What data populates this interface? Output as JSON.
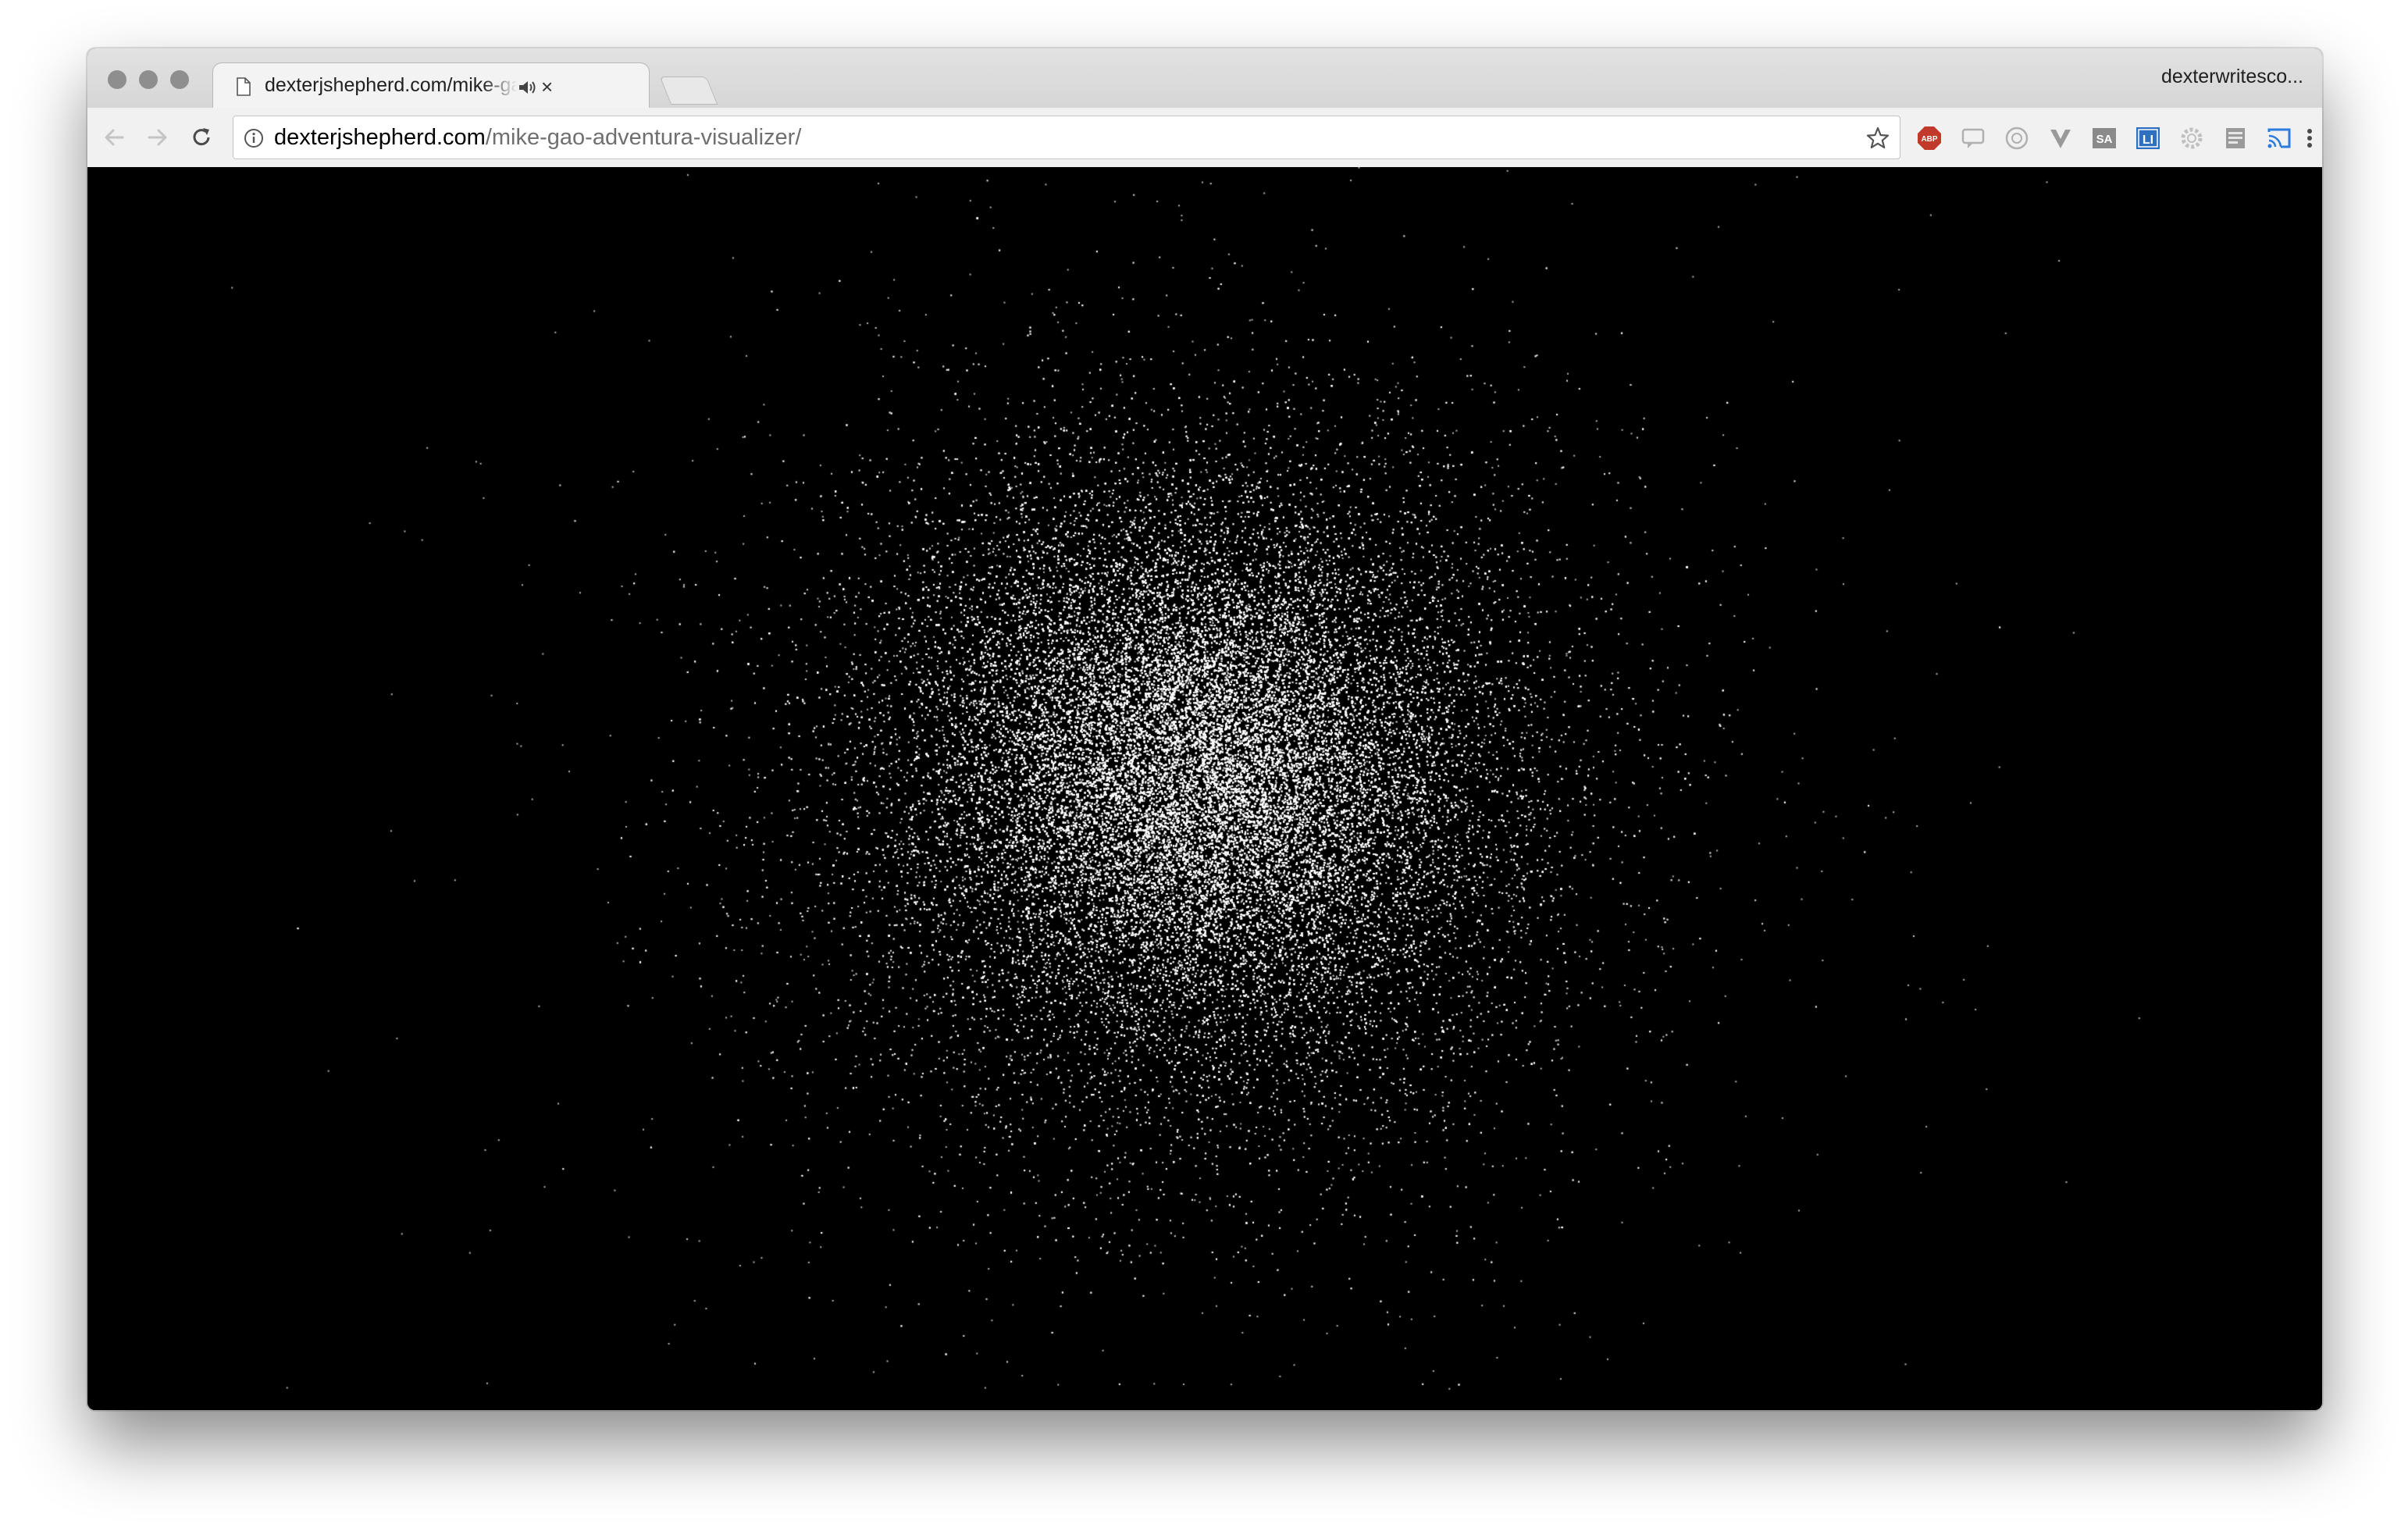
{
  "browser": {
    "tab": {
      "title": "dexterjshepherd.com/mike-gao-adventura-visualizer/",
      "close_glyph": "×"
    },
    "profile_name": "dexterwritesco...",
    "omnibox": {
      "host": "dexterjshepherd.com",
      "path": "/mike-gao-adventura-visualizer/"
    },
    "extensions": [
      {
        "name": "adblock-plus-icon",
        "label": "ABP",
        "color": "#c0392b"
      },
      {
        "name": "chat-bubble-extension-icon",
        "color": "#b0b0b0"
      },
      {
        "name": "circle-extension-icon",
        "color": "#b0b0b0"
      },
      {
        "name": "v-extension-icon",
        "color": "#9a9a9a"
      },
      {
        "name": "sa-extension-icon",
        "label": "SA",
        "color": "#8a8a8a"
      },
      {
        "name": "li-extension-icon",
        "label": "LI",
        "color": "#2f6fbf"
      },
      {
        "name": "gear-extension-icon",
        "color": "#c0c0c0"
      },
      {
        "name": "window-extension-icon",
        "color": "#9a9a9a"
      },
      {
        "name": "cast-icon",
        "color": "#2d7be0"
      },
      {
        "name": "menu-icon"
      }
    ]
  },
  "visualizer": {
    "background": "#000000",
    "particle_color": "#ffffff"
  }
}
